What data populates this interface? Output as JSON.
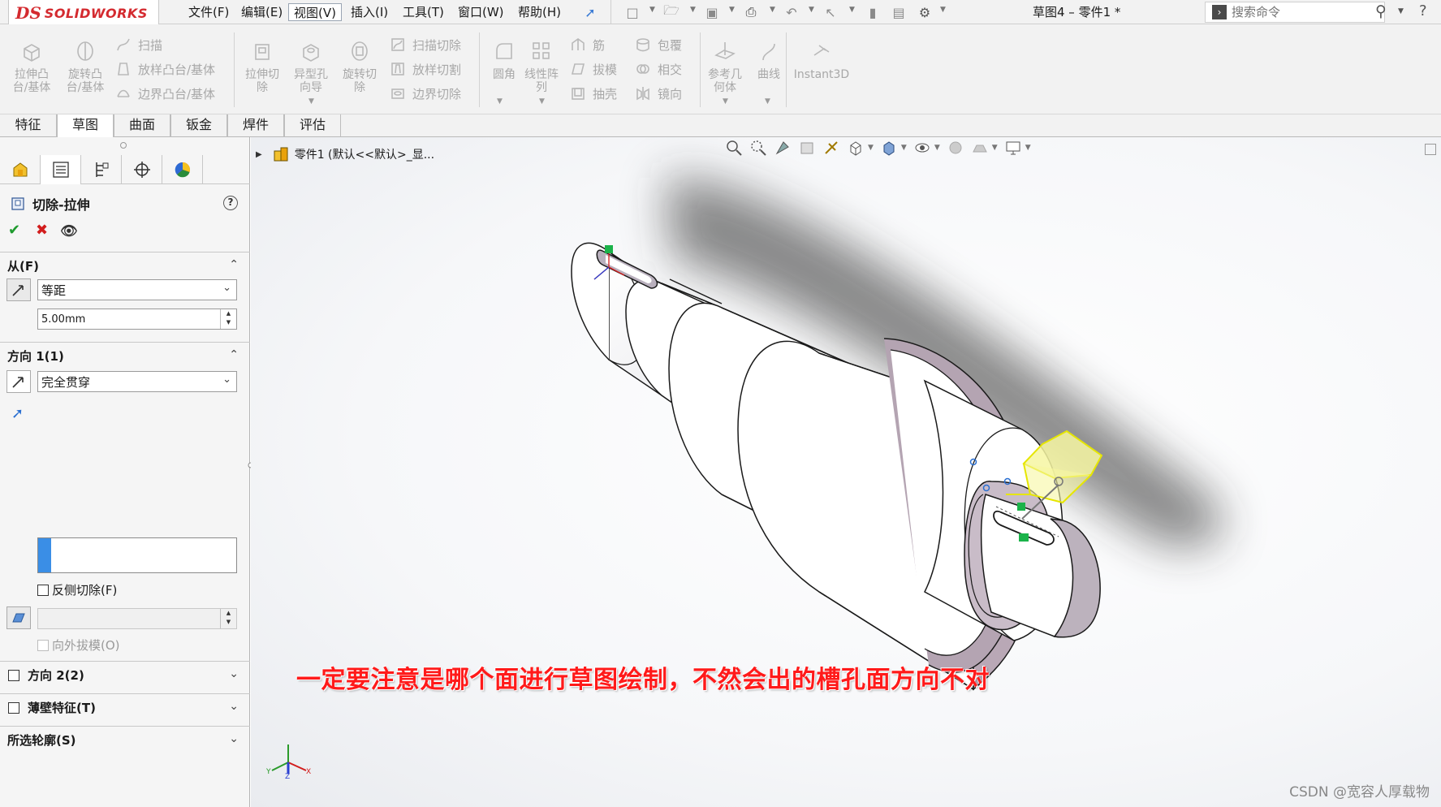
{
  "app": {
    "logo_ds": "DS",
    "logo_text": "SOLIDWORKS",
    "document_title": "草图4 – 零件1 *"
  },
  "menu": [
    {
      "label": "文件(F)"
    },
    {
      "label": "编辑(E)"
    },
    {
      "label": "视图(V)",
      "active": true
    },
    {
      "label": "插入(I)"
    },
    {
      "label": "工具(T)"
    },
    {
      "label": "窗口(W)"
    },
    {
      "label": "帮助(H)"
    }
  ],
  "search": {
    "placeholder": "搜索命令"
  },
  "ribbon": {
    "extrude_boss": "拉伸凸台/基体",
    "revolve_boss": "旋转凸台/基体",
    "sweep": "扫描",
    "loft_boss": "放样凸台/基体",
    "boundary_boss": "边界凸台/基体",
    "extrude_cut": "拉伸切除",
    "hole_wizard": "异型孔向导",
    "revolve_cut": "旋转切除",
    "swept_cut": "扫描切除",
    "lofted_cut": "放样切割",
    "boundary_cut": "边界切除",
    "fillet": "圆角",
    "linear_pattern": "线性阵列",
    "rib": "筋",
    "draft": "拔模",
    "shell": "抽壳",
    "wrap": "包覆",
    "intersect": "相交",
    "mirror": "镜向",
    "ref_geometry": "参考几何体",
    "curves": "曲线",
    "instant3d": "Instant3D"
  },
  "tabs": [
    {
      "label": "特征",
      "active": true
    },
    {
      "label": "草图"
    },
    {
      "label": "曲面"
    },
    {
      "label": "钣金"
    },
    {
      "label": "焊件"
    },
    {
      "label": "评估"
    }
  ],
  "property_manager": {
    "title": "切除-拉伸",
    "from": {
      "heading": "从(F)",
      "type": "等距",
      "distance": "5.00mm"
    },
    "direction1": {
      "heading": "方向 1(1)",
      "end_condition": "完全贯穿",
      "flip_side": "反侧切除(F)",
      "draft_outward": "向外拔模(O)"
    },
    "direction2": {
      "heading": "方向 2(2)"
    },
    "thin_feature": {
      "heading": "薄壁特征(T)"
    },
    "selected_contours": {
      "heading": "所选轮廓(S)"
    }
  },
  "viewport": {
    "tree_item": "零件1  (默认<<默认>_显...",
    "annotation": "一定要注意是哪个面进行草图绘制，不然会出的槽孔面方向不对",
    "watermark": "CSDN @宽容人厚载物"
  },
  "colors": {
    "brand_red": "#d42a2f",
    "annotation_red": "#ff1a1a",
    "sketch_yellow": "#e6e600",
    "accent_blue": "#3a8ee6"
  }
}
